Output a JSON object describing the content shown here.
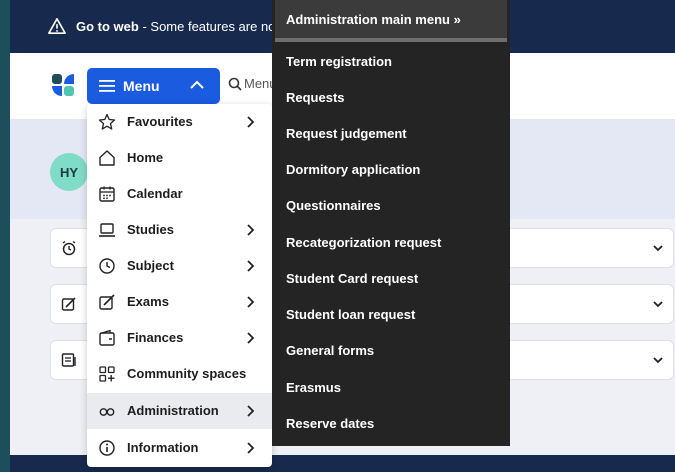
{
  "banner": {
    "bold": "Go to web",
    "text": " - Some features are not av"
  },
  "header": {
    "menu_label": "Menu",
    "search_placeholder": "Menu"
  },
  "avatar": {
    "initials": "HY"
  },
  "main_menu": {
    "items": [
      {
        "label": "Favourites",
        "icon": "star-icon",
        "has_submenu": true
      },
      {
        "label": "Home",
        "icon": "home-icon",
        "has_submenu": false
      },
      {
        "label": "Calendar",
        "icon": "calendar-icon",
        "has_submenu": false
      },
      {
        "label": "Studies",
        "icon": "laptop-icon",
        "has_submenu": true
      },
      {
        "label": "Subject",
        "icon": "clock-icon",
        "has_submenu": true
      },
      {
        "label": "Exams",
        "icon": "pencil-box-icon",
        "has_submenu": true
      },
      {
        "label": "Finances",
        "icon": "wallet-icon",
        "has_submenu": true
      },
      {
        "label": "Community spaces",
        "icon": "grid-plus-icon",
        "has_submenu": false
      },
      {
        "label": "Administration",
        "icon": "infinity-icon",
        "has_submenu": true,
        "active": true
      },
      {
        "label": "Information",
        "icon": "info-icon",
        "has_submenu": true
      }
    ]
  },
  "admin_submenu": {
    "header": "Administration main menu »",
    "items": [
      "Term registration",
      "Requests",
      "Request judgement",
      "Dormitory application",
      "Questionnaires",
      "Recategorization request",
      "Student Card request",
      "Student loan request",
      "General forms",
      "Erasmus",
      "Reserve dates"
    ]
  },
  "colors": {
    "top_bar": "#172a4e",
    "menu_button": "#1a5be0",
    "submenu_bg": "#242424",
    "avatar": "#7fdcc6"
  }
}
